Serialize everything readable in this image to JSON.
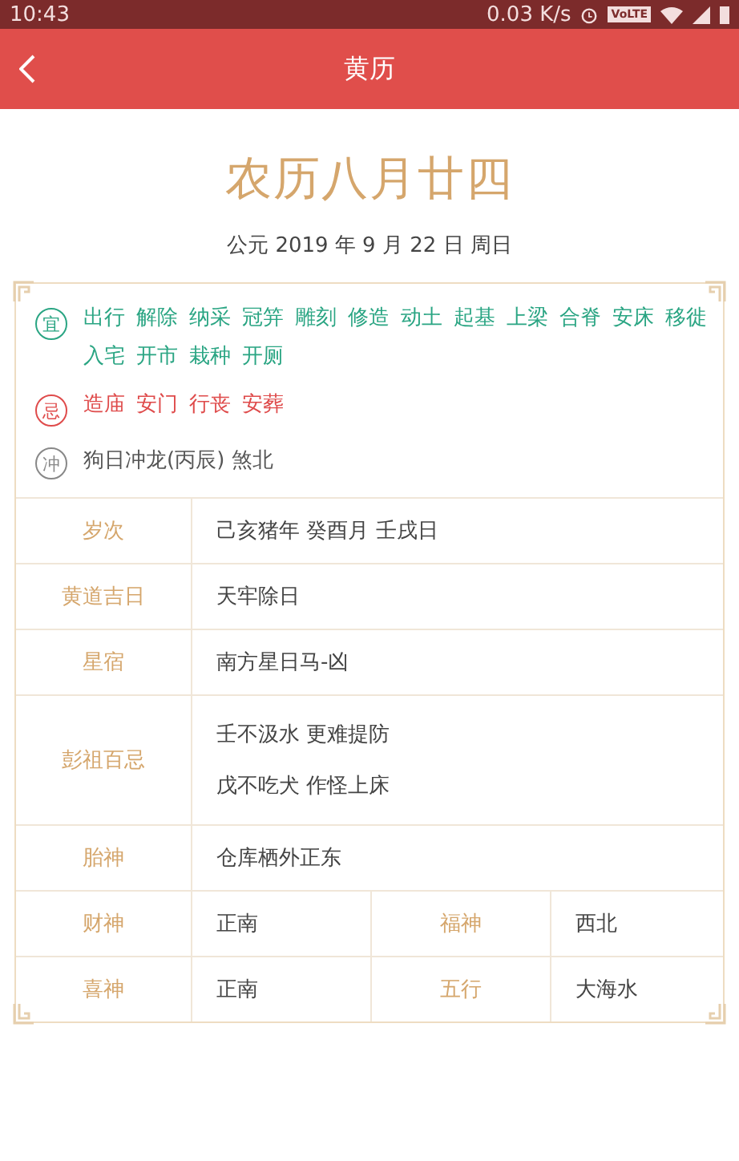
{
  "status_bar": {
    "time": "10:43",
    "speed": "0.03 K/s",
    "network_badge": "VoLTE"
  },
  "app_bar": {
    "title": "黄历"
  },
  "header": {
    "lunar_date": "农历八月廿四",
    "solar_date": "公元 2019 年 9 月 22 日 周日"
  },
  "yi": {
    "badge": "宜",
    "items": [
      "出行",
      "解除",
      "纳采",
      "冠笄",
      "雕刻",
      "修造",
      "动土",
      "起基",
      "上梁",
      "合脊",
      "安床",
      "移徙",
      "入宅",
      "开市",
      "栽种",
      "开厕"
    ]
  },
  "ji": {
    "badge": "忌",
    "items": [
      "造庙",
      "安门",
      "行丧",
      "安葬"
    ]
  },
  "chong": {
    "badge": "冲",
    "text": "狗日冲龙(丙辰) 煞北"
  },
  "table": {
    "rows": [
      {
        "kind": "single",
        "label": "岁次",
        "lines": [
          "己亥猪年 癸酉月 壬戌日"
        ]
      },
      {
        "kind": "single",
        "label": "黄道吉日",
        "lines": [
          "天牢除日"
        ]
      },
      {
        "kind": "single",
        "label": "星宿",
        "lines": [
          "南方星日马-凶"
        ]
      },
      {
        "kind": "single",
        "label": "彭祖百忌",
        "lines": [
          "壬不汲水 更难提防",
          "戊不吃犬 作怪上床"
        ]
      },
      {
        "kind": "single",
        "label": "胎神",
        "lines": [
          "仓库栖外正东"
        ]
      },
      {
        "kind": "double",
        "label": "财神",
        "value": "正南",
        "label2": "福神",
        "value2": "西北"
      },
      {
        "kind": "double",
        "label": "喜神",
        "value": "正南",
        "label2": "五行",
        "value2": "大海水"
      }
    ]
  }
}
